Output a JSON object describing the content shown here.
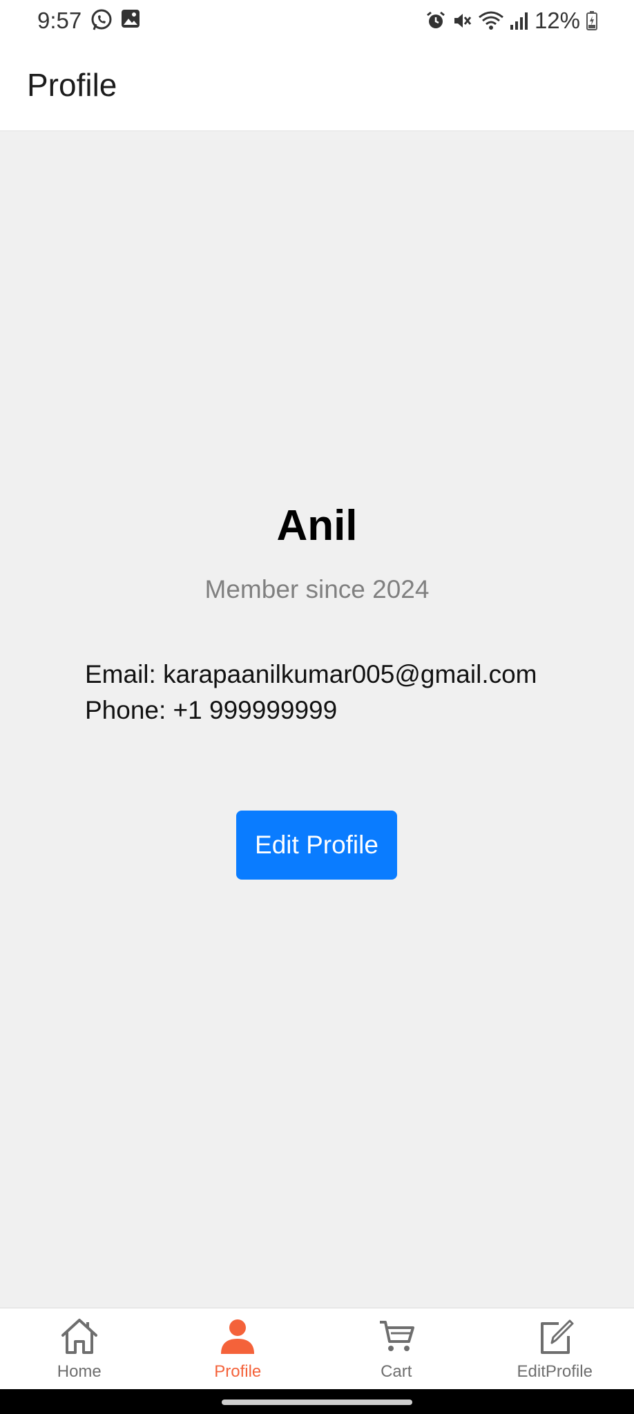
{
  "status_bar": {
    "time": "9:57",
    "battery": "12%",
    "left_icons": [
      "whatsapp-icon",
      "gallery-icon"
    ],
    "right_icons": [
      "alarm-icon",
      "mute-icon",
      "wifi-icon",
      "signal-icon",
      "battery-icon"
    ]
  },
  "header": {
    "title": "Profile"
  },
  "profile": {
    "name": "Anil",
    "member_since": "Member since 2024",
    "email": "Email: karapaanilkumar005@gmail.com",
    "phone": "Phone: +1 999999999",
    "edit_button_label": "Edit Profile"
  },
  "bottom_nav": {
    "items": [
      {
        "label": "Home",
        "icon": "home-icon",
        "active": false
      },
      {
        "label": "Profile",
        "icon": "person-icon",
        "active": true
      },
      {
        "label": "Cart",
        "icon": "cart-icon",
        "active": false
      },
      {
        "label": "EditProfile",
        "icon": "edit-icon",
        "active": false
      }
    ]
  },
  "colors": {
    "accent": "#0a7cff",
    "nav_active": "#f4623a",
    "nav_inactive": "#6e6e6e",
    "background": "#f0f0f0"
  }
}
